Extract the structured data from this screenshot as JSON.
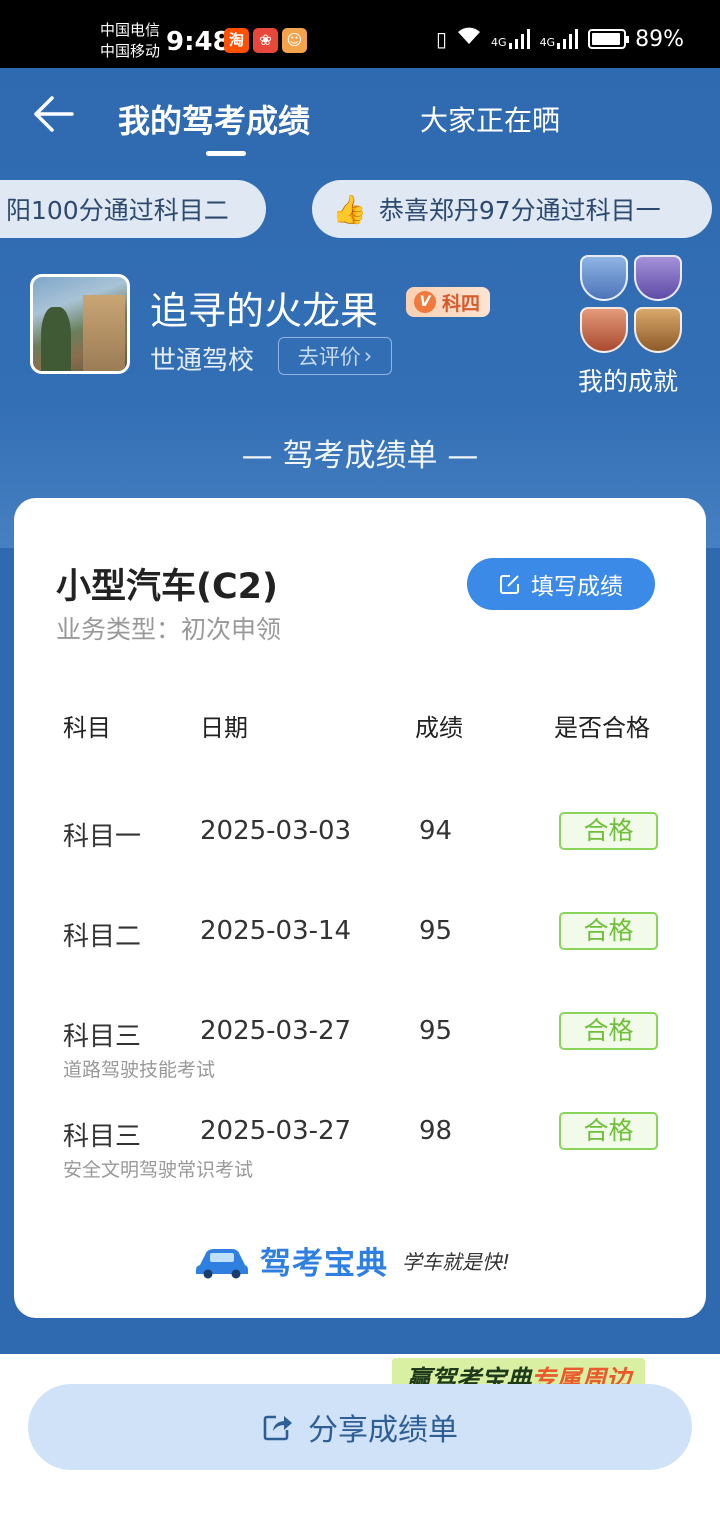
{
  "status_bar": {
    "carrier_1": "中国电信",
    "carrier_2": "中国移动",
    "time": "9:48",
    "network_1": "4G",
    "network_2": "4G",
    "battery": "89%"
  },
  "nav": {
    "title": "我的驾考成绩",
    "other_tab": "大家正在晒"
  },
  "ticker": [
    "阳100分通过科目二",
    "恭喜郑丹97分通过科目一"
  ],
  "profile": {
    "name": "追寻的火龙果",
    "level_badge": "科四",
    "school": "世通驾校",
    "review_button": "去评价",
    "achievements_label": "我的成就"
  },
  "sheet_title": "— 驾考成绩单 —",
  "card": {
    "license_title": "小型汽车(C2)",
    "business_type": "业务类型：初次申领",
    "fill_button": "填写成绩",
    "headers": [
      "科目",
      "日期",
      "成绩",
      "是否合格"
    ],
    "rows": [
      {
        "subject": "科目一",
        "date": "2025-03-03",
        "score": "94",
        "status": "合格",
        "note": ""
      },
      {
        "subject": "科目二",
        "date": "2025-03-14",
        "score": "95",
        "status": "合格",
        "note": ""
      },
      {
        "subject": "科目三",
        "date": "2025-03-27",
        "score": "95",
        "status": "合格",
        "note": "道路驾驶技能考试"
      },
      {
        "subject": "科目三",
        "date": "2025-03-27",
        "score": "98",
        "status": "合格",
        "note": "安全文明驾驶常识考试"
      }
    ],
    "brand_name": "驾考宝典",
    "brand_slogan": "学车就是快!"
  },
  "promo": {
    "prefix": "赢驾考宝典",
    "highlight": "专属周边"
  },
  "share_button": "分享成绩单",
  "colors": {
    "header_bg": "#2f6ab0",
    "accent": "#3b8ae8",
    "pass_green": "#6fbf3a"
  }
}
